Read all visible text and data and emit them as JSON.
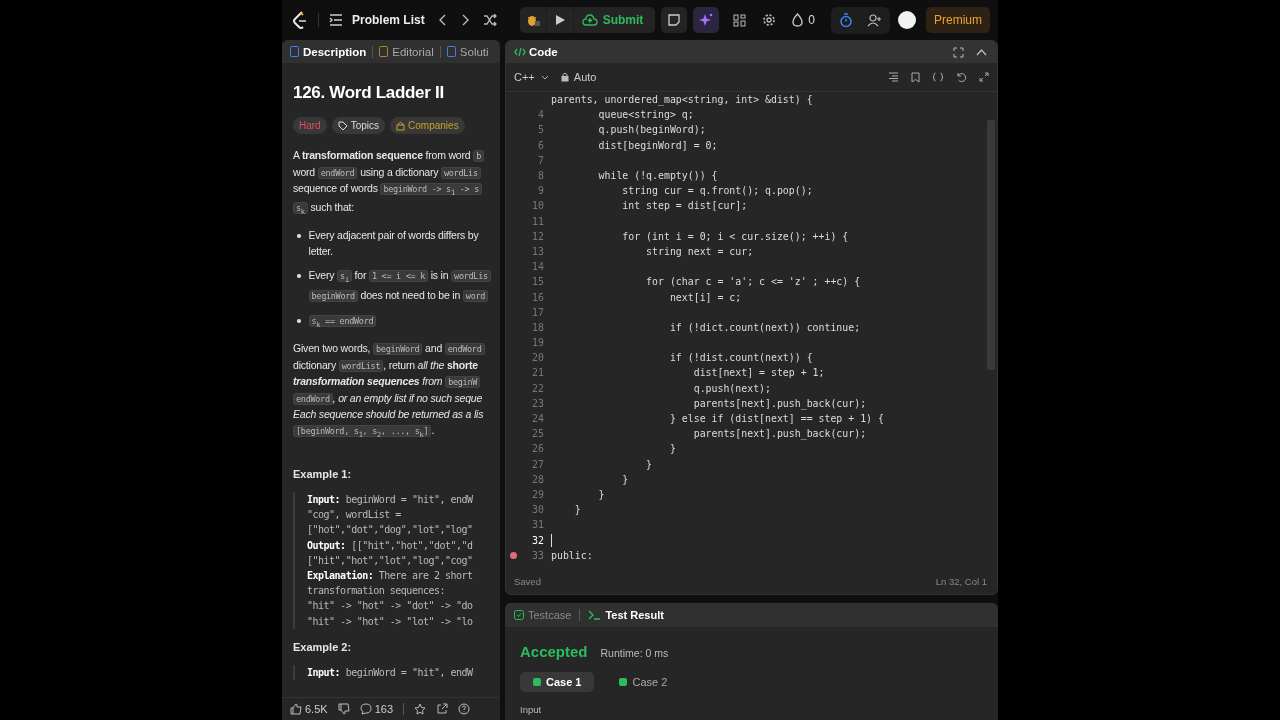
{
  "top_bar": {
    "problem_list": "Problem List",
    "submit": "Submit",
    "streak": "0",
    "premium": "Premium"
  },
  "left_tabs": [
    {
      "label": "Description",
      "selected": true
    },
    {
      "label": "Editorial",
      "selected": false
    },
    {
      "label": "Soluti",
      "selected": false
    }
  ],
  "problem": {
    "title": "126. Word Ladder II",
    "tags": [
      {
        "label": "Hard",
        "kind": "difficulty"
      },
      {
        "label": "Topics",
        "kind": "topics"
      },
      {
        "label": "Companies",
        "kind": "companies"
      }
    ],
    "description": [
      {
        "kind": "paragraph",
        "lines": [
          [
            {
              "kind": "text",
              "text": "A **transformation sequence** from word "
            },
            {
              "kind": "code",
              "text": "b"
            }
          ],
          [
            {
              "kind": "text",
              "text": "word "
            },
            {
              "kind": "code",
              "text": "endWord"
            },
            {
              "kind": "text",
              "text": " using a dictionary "
            },
            {
              "kind": "code",
              "text": "wordLis"
            }
          ],
          [
            {
              "kind": "text",
              "text": "sequence of words "
            },
            {
              "kind": "code",
              "text": "beginWord -> s$_{1}$ -> s"
            }
          ],
          [
            {
              "kind": "code",
              "text": "s$_{k}$"
            },
            {
              "kind": "text",
              "text": " such that:"
            }
          ]
        ]
      },
      {
        "kind": "bullet",
        "lines": [
          [
            {
              "kind": "text",
              "text": "Every adjacent pair of words differs by"
            }
          ],
          [
            {
              "kind": "text",
              "text": "letter."
            }
          ]
        ]
      },
      {
        "kind": "bullet",
        "lines": [
          [
            {
              "kind": "text",
              "text": "Every "
            },
            {
              "kind": "code",
              "text": "s$_{i}$"
            },
            {
              "kind": "text",
              "text": " for "
            },
            {
              "kind": "code",
              "text": "1 <= i <= k"
            },
            {
              "kind": "text",
              "text": " is in "
            },
            {
              "kind": "code",
              "text": "wordLis"
            }
          ],
          [
            {
              "kind": "code",
              "text": "beginWord"
            },
            {
              "kind": "text",
              "text": " does not need to be in "
            },
            {
              "kind": "code",
              "text": "word"
            }
          ]
        ]
      },
      {
        "kind": "bullet",
        "lines": [
          [
            {
              "kind": "code",
              "text": "s$_{k}$ == endWord"
            }
          ]
        ]
      },
      {
        "kind": "paragraph",
        "lines": [
          [
            {
              "kind": "text",
              "text": "Given two words, "
            },
            {
              "kind": "code",
              "text": "beginWord"
            },
            {
              "kind": "text",
              "text": " and "
            },
            {
              "kind": "code",
              "text": "endWord"
            }
          ],
          [
            {
              "kind": "text",
              "text": "dictionary "
            },
            {
              "kind": "code",
              "text": "wordList"
            },
            {
              "kind": "text",
              "text": ", return *all the* **shorte**"
            }
          ],
          [
            {
              "kind": "em",
              "text": "**transformation sequences** from "
            },
            {
              "kind": "code",
              "text": "beginW"
            }
          ],
          [
            {
              "kind": "code",
              "text": "endWord"
            },
            {
              "kind": "em",
              "text": ", or an empty list if no such seque"
            }
          ],
          [
            {
              "kind": "em",
              "text": "Each sequence should be returned as a lis"
            }
          ],
          [
            {
              "kind": "code",
              "text": "[beginWord, s$_{1}$, s$_{2}$, ..., s$_{k}$]"
            },
            {
              "kind": "text",
              "text": "."
            }
          ]
        ]
      }
    ],
    "examples": [
      {
        "title": "Example 1:",
        "lines": [
          "**Input:** beginWord = \"hit\", endW",
          "\"cog\", wordList =",
          "[\"hot\",\"dot\",\"dog\",\"lot\",\"log\"",
          "**Output:** [[\"hit\",\"hot\",\"dot\",\"d",
          "[\"hit\",\"hot\",\"lot\",\"log\",\"cog\"",
          "**Explanation:** There are 2 short",
          "transformation sequences:",
          "\"hit\" -> \"hot\" -> \"dot\" -> \"do",
          "\"hit\" -> \"hot\" -> \"lot\" -> \"lo"
        ]
      },
      {
        "title": "Example 2:",
        "lines": [
          "**Input:** beginWord = \"hit\", endW"
        ]
      }
    ]
  },
  "footer": {
    "likes": "6.5K",
    "comments": "163"
  },
  "editor": {
    "title": "Code",
    "language": "C++",
    "mode": "Auto",
    "status": "Saved",
    "cursor": "Ln 32, Col 1",
    "lines": [
      {
        "text": "parents, unordered_map<string, int> &dist) {",
        "current": false,
        "breakpoint": false
      },
      {
        "number": "4",
        "text": "        queue<string> q;",
        "current": false,
        "breakpoint": false
      },
      {
        "number": "5",
        "text": "        q.push(beginWord);",
        "current": false,
        "breakpoint": false
      },
      {
        "number": "6",
        "text": "        dist[beginWord] = 0;",
        "current": false,
        "breakpoint": false
      },
      {
        "number": "7",
        "current": false,
        "breakpoint": false
      },
      {
        "number": "8",
        "text": "        while (!q.empty()) {",
        "current": false,
        "breakpoint": false
      },
      {
        "number": "9",
        "text": "            string cur = q.front(); q.pop();",
        "current": false,
        "breakpoint": false
      },
      {
        "number": "10",
        "text": "            int step = dist[cur];",
        "current": false,
        "breakpoint": false
      },
      {
        "number": "11",
        "current": false,
        "breakpoint": false
      },
      {
        "number": "12",
        "text": "            for (int i = 0; i < cur.size(); ++i) {",
        "current": false,
        "breakpoint": false
      },
      {
        "number": "13",
        "text": "                string next = cur;",
        "current": false,
        "breakpoint": false
      },
      {
        "number": "14",
        "current": false,
        "breakpoint": false
      },
      {
        "number": "15",
        "text": "                for (char c = 'a'; c <= 'z' ; ++c) {",
        "current": false,
        "breakpoint": false
      },
      {
        "number": "16",
        "text": "                    next[i] = c;",
        "current": false,
        "breakpoint": false
      },
      {
        "number": "17",
        "current": false,
        "breakpoint": false
      },
      {
        "number": "18",
        "text": "                    if (!dict.count(next)) continue;",
        "current": false,
        "breakpoint": false
      },
      {
        "number": "19",
        "current": false,
        "breakpoint": false
      },
      {
        "number": "20",
        "text": "                    if (!dist.count(next)) {",
        "current": false,
        "breakpoint": false
      },
      {
        "number": "21",
        "text": "                        dist[next] = step + 1;",
        "current": false,
        "breakpoint": false
      },
      {
        "number": "22",
        "text": "                        q.push(next);",
        "current": false,
        "breakpoint": false
      },
      {
        "number": "23",
        "text": "                        parents[next].push_back(cur);",
        "current": false,
        "breakpoint": false
      },
      {
        "number": "24",
        "text": "                    } else if (dist[next] == step + 1) {",
        "current": false,
        "breakpoint": false
      },
      {
        "number": "25",
        "text": "                        parents[next].push_back(cur);",
        "current": false,
        "breakpoint": false
      },
      {
        "number": "26",
        "text": "                    }",
        "current": false,
        "breakpoint": false
      },
      {
        "number": "27",
        "text": "                }",
        "current": false,
        "breakpoint": false
      },
      {
        "number": "28",
        "text": "            }",
        "current": false,
        "breakpoint": false
      },
      {
        "number": "29",
        "text": "        }",
        "current": false,
        "breakpoint": false
      },
      {
        "number": "30",
        "text": "    }",
        "current": false,
        "breakpoint": false
      },
      {
        "number": "31",
        "current": false,
        "breakpoint": false
      },
      {
        "number": "32",
        "current": true,
        "breakpoint": false
      },
      {
        "number": "33",
        "text": "public:",
        "current": false,
        "breakpoint": true
      }
    ]
  },
  "result_tabs": [
    {
      "label": "Testcase",
      "kind": "testcase",
      "selected": false
    },
    {
      "label": "Test Result",
      "kind": "result",
      "selected": true
    }
  ],
  "result": {
    "verdict": "Accepted",
    "runtime": "Runtime: 0 ms",
    "cases": [
      {
        "label": "Case 1",
        "selected": true
      },
      {
        "label": "Case 2",
        "selected": false
      }
    ],
    "input_label": "Input"
  }
}
